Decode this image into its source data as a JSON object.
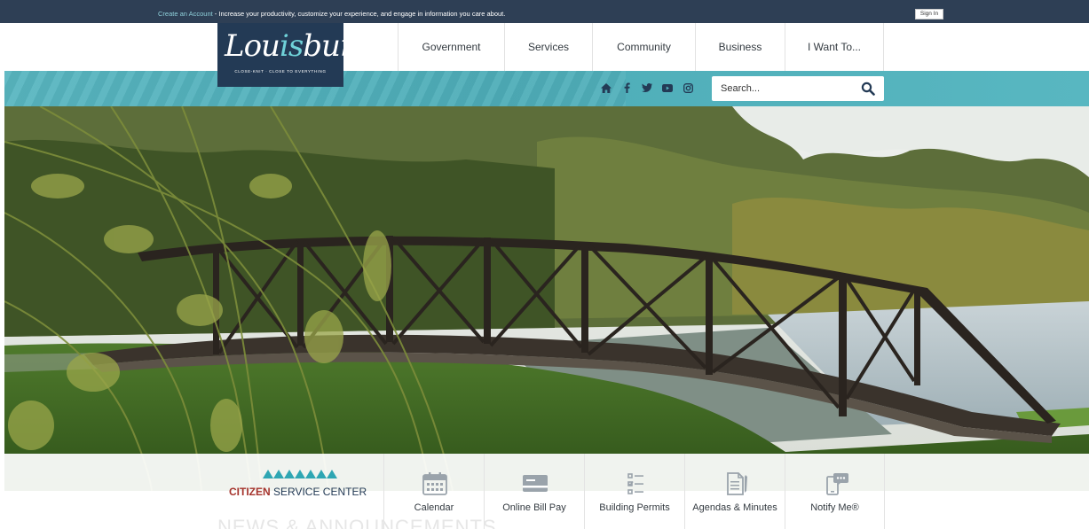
{
  "topbar": {
    "create_link": "Create an Account",
    "message": " - Increase your productivity, customize your experience, and engage in information you care about.",
    "signin_label": "Sign In"
  },
  "logo": {
    "text_pre": "Lou",
    "text_is": "is",
    "text_post": "burg",
    "tagline": "CLOSE-KNIT · CLOSE TO EVERYTHING"
  },
  "nav": {
    "items": [
      {
        "label": "Government"
      },
      {
        "label": "Services"
      },
      {
        "label": "Community"
      },
      {
        "label": "Business"
      },
      {
        "label": "I Want To..."
      }
    ]
  },
  "social": {
    "icons": [
      "home-icon",
      "facebook-icon",
      "twitter-icon",
      "youtube-icon",
      "instagram-icon"
    ]
  },
  "search": {
    "placeholder": "Search..."
  },
  "csc": {
    "title_bold": "CITIZEN",
    "title_rest": " SERVICE CENTER"
  },
  "quick_links": [
    {
      "label": "Calendar",
      "icon": "calendar-icon"
    },
    {
      "label": "Online Bill Pay",
      "icon": "credit-card-icon"
    },
    {
      "label": "Building Permits",
      "icon": "checklist-icon"
    },
    {
      "label": "Agendas & Minutes",
      "icon": "document-icon"
    },
    {
      "label": "Notify Me®",
      "icon": "notify-phone-icon"
    }
  ],
  "news": {
    "heading": "NEWS & ANNOUNCEMENTS"
  },
  "colors": {
    "topbar": "#2e3f55",
    "teal": "#54b1bc",
    "navy": "#233a55",
    "accent_red": "#a5332c"
  }
}
